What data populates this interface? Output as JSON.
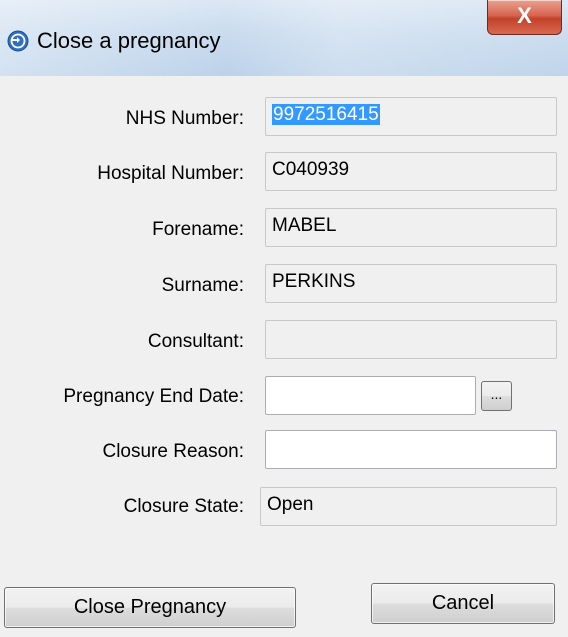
{
  "window": {
    "title": "Close a pregnancy",
    "close_glyph": "X",
    "icon": "circle-arrows-icon"
  },
  "form": {
    "nhs_number": {
      "label": "NHS Number:",
      "value": "9972516415"
    },
    "hospital_number": {
      "label": "Hospital Number:",
      "value": "C040939"
    },
    "forename": {
      "label": "Forename:",
      "value": "MABEL"
    },
    "surname": {
      "label": "Surname:",
      "value": "PERKINS"
    },
    "consultant": {
      "label": "Consultant:",
      "value": ""
    },
    "pregnancy_end_date": {
      "label": "Pregnancy End Date:",
      "value": "",
      "picker_label": "..."
    },
    "closure_reason": {
      "label": "Closure Reason:",
      "value": ""
    },
    "closure_state": {
      "label": "Closure State:",
      "value": "Open"
    }
  },
  "buttons": {
    "close_pregnancy": "Close Pregnancy",
    "cancel": "Cancel"
  },
  "colors": {
    "title_bar": "#c9dbee",
    "close_button": "#c2412a",
    "selection": "#3399ff",
    "window_bg": "#f0f0f0"
  }
}
